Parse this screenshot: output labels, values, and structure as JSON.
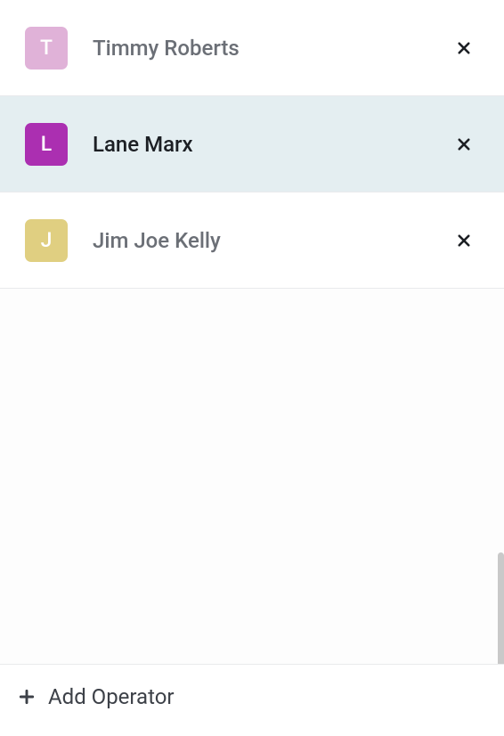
{
  "operators": [
    {
      "name": "Timmy Roberts",
      "initial": "T",
      "avatarColor": "#e0b2d8",
      "selected": false
    },
    {
      "name": "Lane Marx",
      "initial": "L",
      "avatarColor": "#ab2fb1",
      "selected": true
    },
    {
      "name": "Jim Joe Kelly",
      "initial": "J",
      "avatarColor": "#e0cf81",
      "selected": false
    }
  ],
  "footer": {
    "addOperatorLabel": "Add Operator"
  }
}
